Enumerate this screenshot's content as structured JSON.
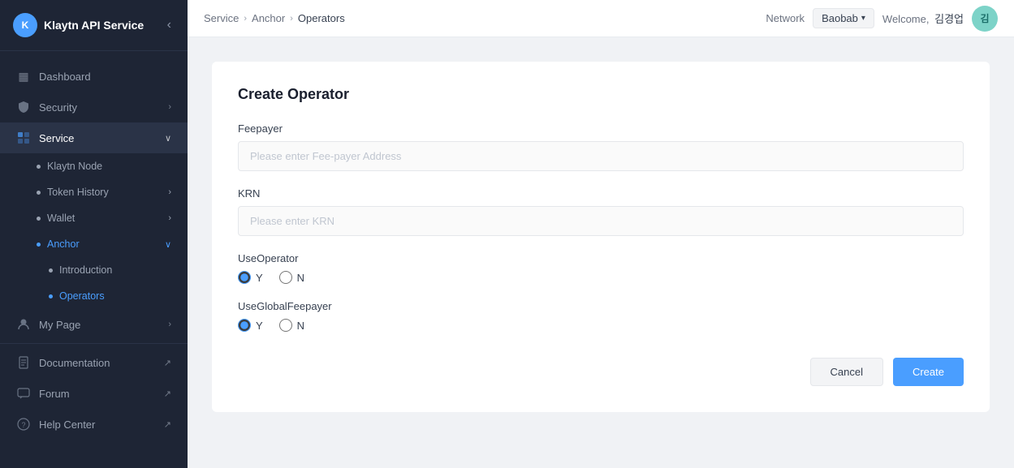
{
  "logo": {
    "icon_text": "K",
    "text": "Klaytn API Service"
  },
  "sidebar": {
    "collapse_icon": "‹",
    "items": [
      {
        "id": "dashboard",
        "label": "Dashboard",
        "icon": "▦",
        "has_chevron": false,
        "active": false
      },
      {
        "id": "security",
        "label": "Security",
        "icon": "🔒",
        "has_chevron": true,
        "active": false
      },
      {
        "id": "service",
        "label": "Service",
        "icon": "⊞",
        "has_chevron": true,
        "active": true,
        "expanded": true
      },
      {
        "id": "klaytn-node",
        "label": "Klaytn Node",
        "is_sub": true,
        "active": false
      },
      {
        "id": "token-history",
        "label": "Token History",
        "is_sub": true,
        "has_chevron": true,
        "active": false
      },
      {
        "id": "wallet",
        "label": "Wallet",
        "is_sub": true,
        "has_chevron": true,
        "active": false
      },
      {
        "id": "anchor",
        "label": "Anchor",
        "is_sub": true,
        "has_chevron": true,
        "active": true,
        "expanded": true
      },
      {
        "id": "introduction",
        "label": "Introduction",
        "is_subsub": true,
        "active": false
      },
      {
        "id": "operators",
        "label": "Operators",
        "is_subsub": true,
        "active": true
      },
      {
        "id": "my-page",
        "label": "My Page",
        "icon": "👤",
        "has_chevron": true,
        "active": false
      },
      {
        "id": "documentation",
        "label": "Documentation",
        "icon": "📄",
        "has_ext": true,
        "active": false
      },
      {
        "id": "forum",
        "label": "Forum",
        "icon": "💬",
        "has_ext": true,
        "active": false
      },
      {
        "id": "help-center",
        "label": "Help Center",
        "icon": "❓",
        "has_ext": true,
        "active": false
      }
    ]
  },
  "header": {
    "breadcrumb": [
      {
        "label": "Service",
        "active": false
      },
      {
        "label": "Anchor",
        "active": false
      },
      {
        "label": "Operators",
        "active": true
      }
    ],
    "network_label": "Network",
    "network_value": "Baobab",
    "welcome_text": "Welcome,",
    "username": "김경업",
    "avatar_text": "김"
  },
  "form": {
    "title": "Create Operator",
    "feepayer_label": "Feepayer",
    "feepayer_placeholder": "Please enter Fee-payer Address",
    "krn_label": "KRN",
    "krn_placeholder": "Please enter KRN",
    "use_operator_label": "UseOperator",
    "use_global_feepayer_label": "UseGlobalFeepayer",
    "radio_y": "Y",
    "radio_n": "N",
    "cancel_label": "Cancel",
    "create_label": "Create"
  }
}
